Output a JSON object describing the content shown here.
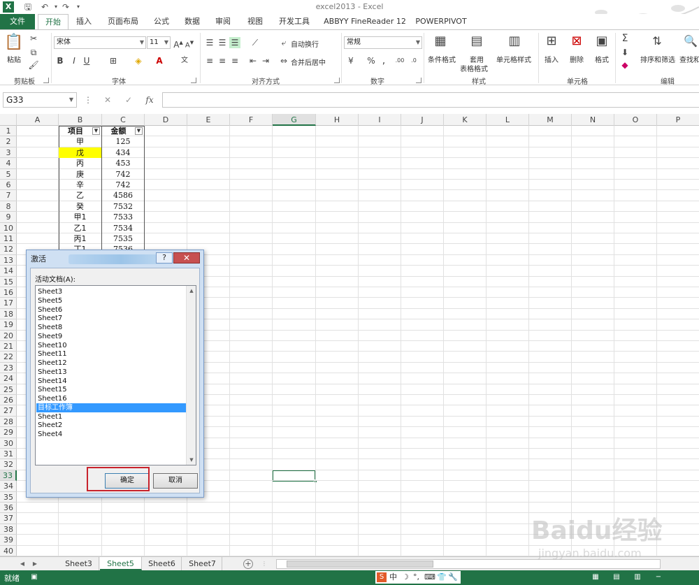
{
  "window": {
    "title": "excel2013 - Excel",
    "app_badge": "X"
  },
  "tabs": [
    "文件",
    "开始",
    "插入",
    "页面布局",
    "公式",
    "数据",
    "审阅",
    "视图",
    "开发工具",
    "ABBYY FineReader 12",
    "POWERPIVOT"
  ],
  "ribbon": {
    "clipboard": {
      "paste": "粘贴",
      "label": "剪贴板"
    },
    "font": {
      "name": "宋体",
      "size": "11",
      "label": "字体",
      "bold": "B",
      "italic": "I",
      "underline": "U"
    },
    "alignment": {
      "wrap": "自动换行",
      "merge": "合并后居中",
      "label": "对齐方式"
    },
    "number": {
      "format": "常规",
      "label": "数字"
    },
    "styles": {
      "conditional": "条件格式",
      "table1": "套用",
      "table2": "表格格式",
      "cell_styles": "单元格样式",
      "label": "样式"
    },
    "cells": {
      "insert": "插入",
      "delete": "删除",
      "format": "格式",
      "label": "单元格"
    },
    "editing": {
      "sort": "排序和筛选",
      "find": "查找和",
      "label": "编辑"
    }
  },
  "formula_bar": {
    "name_box": "G33",
    "cancel": "✕",
    "enter": "✓",
    "fx": "fx"
  },
  "columns": [
    "A",
    "B",
    "C",
    "D",
    "E",
    "F",
    "G",
    "H",
    "I",
    "J",
    "K",
    "L",
    "M",
    "N",
    "O",
    "P"
  ],
  "selected_column": "G",
  "selected_row": "33",
  "rows": [
    "1",
    "2",
    "3",
    "4",
    "5",
    "6",
    "7",
    "8",
    "9",
    "10",
    "11",
    "12",
    "13",
    "14",
    "15",
    "16",
    "17",
    "18",
    "19",
    "20",
    "21",
    "22",
    "23",
    "24",
    "25",
    "26",
    "27",
    "28",
    "29",
    "30",
    "31",
    "32",
    "33",
    "34",
    "35",
    "36",
    "37",
    "38",
    "39",
    "40"
  ],
  "table": {
    "headers": [
      "项目",
      "金额"
    ],
    "rows": [
      [
        "甲",
        "125"
      ],
      [
        "戊",
        "434"
      ],
      [
        "丙",
        "453"
      ],
      [
        "庚",
        "742"
      ],
      [
        "辛",
        "742"
      ],
      [
        "乙",
        "4586"
      ],
      [
        "癸",
        "7532"
      ],
      [
        "甲1",
        "7533"
      ],
      [
        "乙1",
        "7534"
      ],
      [
        "丙1",
        "7535"
      ],
      [
        "丁1",
        "7536"
      ]
    ],
    "highlight_row_index": 1,
    "highlight_color": "#ffff00"
  },
  "dialog": {
    "title": "激活",
    "help": "?",
    "list_label": "活动文档(A):",
    "items": [
      "Sheet3",
      "Sheet5",
      "Sheet6",
      "Sheet7",
      "Sheet8",
      "Sheet9",
      "Sheet10",
      "Sheet11",
      "Sheet12",
      "Sheet13",
      "Sheet14",
      "Sheet15",
      "Sheet16",
      "目标工作簿",
      "Sheet1",
      "Sheet2",
      "Sheet4"
    ],
    "selected_index": 13,
    "ok": "确定",
    "cancel": "取消"
  },
  "sheet_tabs": [
    "Sheet3",
    "Sheet5",
    "Sheet6",
    "Sheet7"
  ],
  "active_sheet": "Sheet5",
  "status": {
    "ready": "就绪",
    "ime": "中"
  },
  "watermark": {
    "brand": "Baidu经验",
    "url": "jingyan.baidu.com"
  },
  "colors": {
    "accent": "#217346",
    "highlight_box": "#c8232c",
    "list_selection": "#3399ff"
  }
}
